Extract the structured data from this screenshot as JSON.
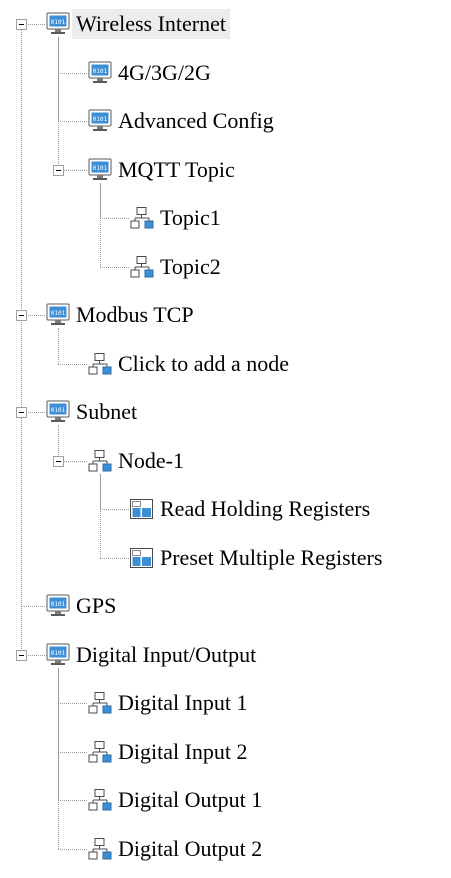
{
  "tree": {
    "items": [
      {
        "label": "Wireless Internet",
        "icon": "computer-icon",
        "level": 0,
        "expanded": true,
        "selected": true
      },
      {
        "label": "4G/3G/2G",
        "icon": "computer-icon",
        "level": 1
      },
      {
        "label": "Advanced Config",
        "icon": "computer-icon",
        "level": 1
      },
      {
        "label": "MQTT Topic",
        "icon": "computer-icon",
        "level": 1,
        "expanded": true
      },
      {
        "label": "Topic1",
        "icon": "network-node-icon",
        "level": 2
      },
      {
        "label": "Topic2",
        "icon": "network-node-icon",
        "level": 2
      },
      {
        "label": "Modbus TCP",
        "icon": "computer-icon",
        "level": 0,
        "expanded": true
      },
      {
        "label": "Click to add a node",
        "icon": "network-node-icon",
        "level": 1
      },
      {
        "label": "Subnet",
        "icon": "computer-icon",
        "level": 0,
        "expanded": true
      },
      {
        "label": "Node-1",
        "icon": "network-node-icon",
        "level": 1,
        "expanded": true
      },
      {
        "label": "Read Holding Registers",
        "icon": "register-icon",
        "level": 2
      },
      {
        "label": "Preset Multiple Registers",
        "icon": "register-icon",
        "level": 2
      },
      {
        "label": "GPS",
        "icon": "computer-icon",
        "level": 0
      },
      {
        "label": "Digital Input/Output",
        "icon": "computer-icon",
        "level": 0,
        "expanded": true
      },
      {
        "label": "Digital Input 1",
        "icon": "network-node-icon",
        "level": 1
      },
      {
        "label": "Digital Input 2",
        "icon": "network-node-icon",
        "level": 1
      },
      {
        "label": "Digital Output 1",
        "icon": "network-node-icon",
        "level": 1
      },
      {
        "label": "Digital Output 2",
        "icon": "network-node-icon",
        "level": 1
      }
    ],
    "colors": {
      "selection": "#ececec",
      "icon_blue": "#3c8fd6",
      "connector": "#9a9a9a"
    }
  }
}
